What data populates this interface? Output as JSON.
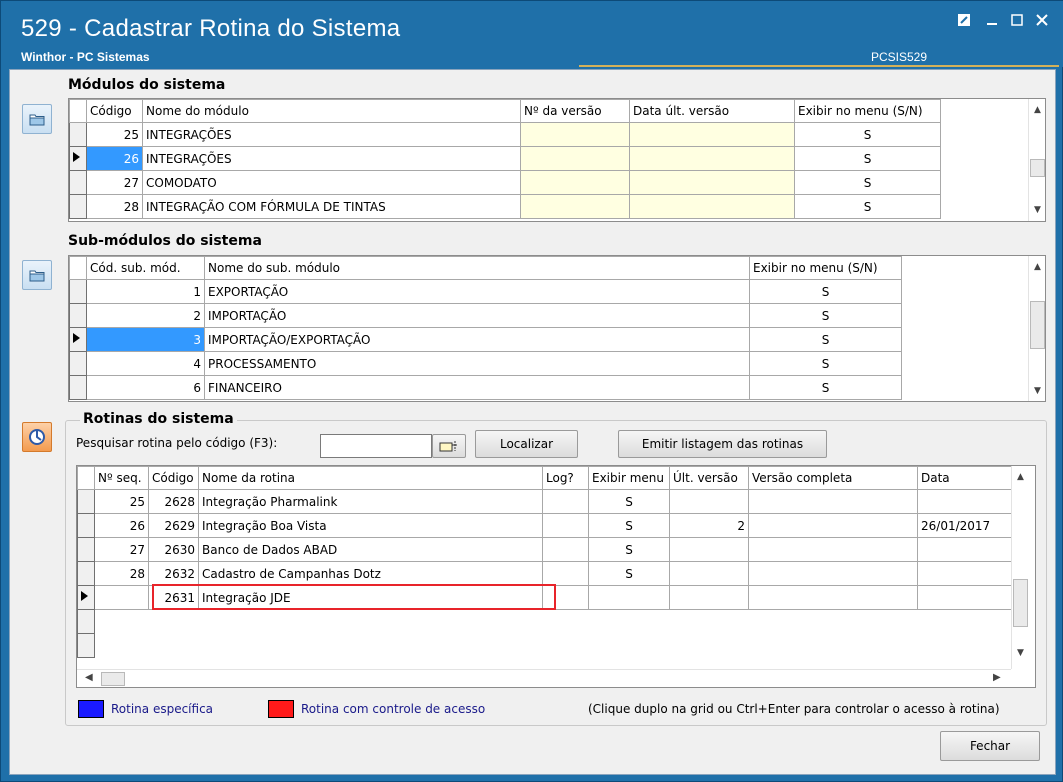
{
  "window": {
    "title": "529 - Cadastrar Rotina do Sistema",
    "subtitle": "Winthor - PC Sistemas",
    "code": "PCSIS529"
  },
  "modulos": {
    "header": "Módulos do sistema",
    "columns": [
      "Código",
      "Nome do módulo",
      "Nº da versão",
      "Data últ. versão",
      "Exibir no menu (S/N)"
    ],
    "rows": [
      {
        "codigo": "25",
        "nome": "INTEGRAÇÕES",
        "versao": "",
        "data": "",
        "exibir": "S",
        "selected": false
      },
      {
        "codigo": "26",
        "nome": "INTEGRAÇÕES",
        "versao": "",
        "data": "",
        "exibir": "S",
        "selected": true
      },
      {
        "codigo": "27",
        "nome": "COMODATO",
        "versao": "",
        "data": "",
        "exibir": "S",
        "selected": false
      },
      {
        "codigo": "28",
        "nome": "INTEGRAÇÃO COM FÓRMULA DE TINTAS",
        "versao": "",
        "data": "",
        "exibir": "S",
        "selected": false
      }
    ]
  },
  "submodulos": {
    "header": "Sub-módulos do sistema",
    "columns": [
      "Cód. sub. mód.",
      "Nome do sub. módulo",
      "Exibir no menu (S/N)"
    ],
    "rows": [
      {
        "codigo": "1",
        "nome": "EXPORTAÇÃO",
        "exibir": "S",
        "selected": false
      },
      {
        "codigo": "2",
        "nome": "IMPORTAÇÃO",
        "exibir": "S",
        "selected": false
      },
      {
        "codigo": "3",
        "nome": "IMPORTAÇÃO/EXPORTAÇÃO",
        "exibir": "S",
        "selected": true
      },
      {
        "codigo": "4",
        "nome": "PROCESSAMENTO",
        "exibir": "S",
        "selected": false
      },
      {
        "codigo": "6",
        "nome": "FINANCEIRO",
        "exibir": "S",
        "selected": false
      }
    ]
  },
  "rotinas": {
    "header": "Rotinas do sistema",
    "search_label": "Pesquisar rotina pelo código (F3):",
    "search_value": "",
    "localizar": "Localizar",
    "emitir": "Emitir listagem das rotinas",
    "columns": [
      "Nº seq.",
      "Código",
      "Nome da rotina",
      "Log?",
      "Exibir menu",
      "Últ. versão",
      "Versão completa",
      "Data"
    ],
    "rows": [
      {
        "seq": "25",
        "codigo": "2628",
        "nome": "Integração Pharmalink",
        "log": "",
        "exibir": "S",
        "ult": "",
        "completa": "",
        "data": ""
      },
      {
        "seq": "26",
        "codigo": "2629",
        "nome": "Integração Boa Vista",
        "log": "",
        "exibir": "S",
        "ult": "2",
        "completa": "",
        "data": "26/01/2017"
      },
      {
        "seq": "27",
        "codigo": "2630",
        "nome": "Banco de Dados ABAD",
        "log": "",
        "exibir": "S",
        "ult": "",
        "completa": "",
        "data": ""
      },
      {
        "seq": "28",
        "codigo": "2632",
        "nome": "Cadastro de Campanhas Dotz",
        "log": "",
        "exibir": "S",
        "ult": "",
        "completa": "",
        "data": ""
      },
      {
        "seq": "",
        "codigo": "2631",
        "nome": "Integração JDE",
        "log": "",
        "exibir": "",
        "ult": "",
        "completa": "",
        "data": ""
      }
    ]
  },
  "legend": {
    "especifica": "Rotina específica",
    "controle": "Rotina com controle de acesso",
    "hint": "(Clique duplo na grid ou Ctrl+Enter para controlar o acesso à rotina)",
    "colors": {
      "especifica": "#1a1aff",
      "controle": "#ff1a1a"
    }
  },
  "footer": {
    "fechar": "Fechar"
  },
  "colors": {
    "title_bg": "#1f70a9",
    "selection": "#3399ff",
    "highlight_border": "#e8242a"
  }
}
